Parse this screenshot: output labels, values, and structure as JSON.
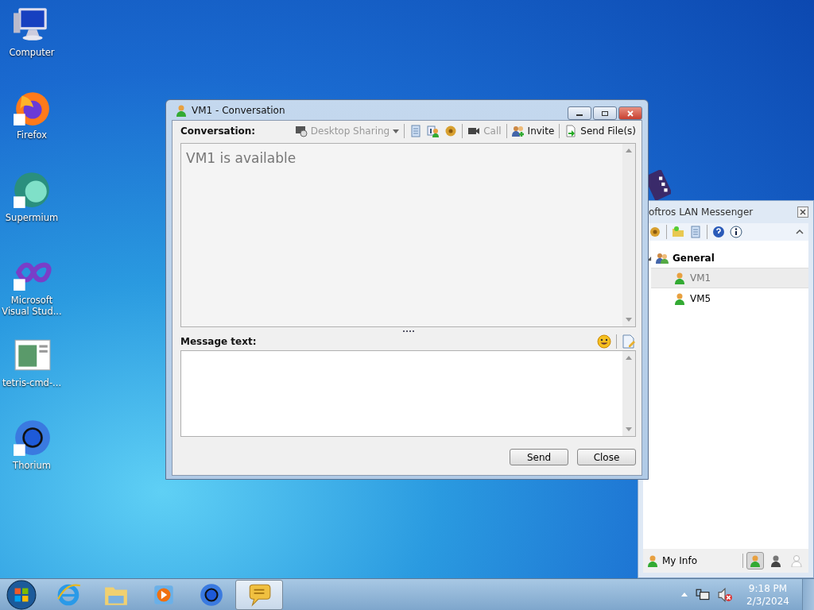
{
  "desktop_icons": [
    {
      "label": "Computer",
      "kind": "computer",
      "shortcut": false
    },
    {
      "label": "Firefox",
      "kind": "firefox",
      "shortcut": true
    },
    {
      "label": "Supermium",
      "kind": "supermium",
      "shortcut": true
    },
    {
      "label": "Microsoft Visual Stud...",
      "kind": "visualstudio",
      "shortcut": true
    },
    {
      "label": "tetris-cmd-...",
      "kind": "document",
      "shortcut": false
    },
    {
      "label": "Thorium",
      "kind": "thorium",
      "shortcut": true
    }
  ],
  "conversation_window": {
    "title": "VM1 - Conversation",
    "conversation_label": "Conversation:",
    "toolbar": [
      {
        "kind": "desktop-sharing",
        "label": "Desktop Sharing",
        "disabled": true
      },
      {
        "kind": "separator"
      },
      {
        "kind": "history"
      },
      {
        "kind": "info"
      },
      {
        "kind": "gear"
      },
      {
        "kind": "separator"
      },
      {
        "kind": "call",
        "label": "Call",
        "disabled": true
      },
      {
        "kind": "separator"
      },
      {
        "kind": "invite",
        "label": "Invite",
        "disabled": false
      },
      {
        "kind": "separator"
      },
      {
        "kind": "send-file",
        "label": "Send File(s)",
        "disabled": false
      }
    ],
    "status_text": "VM1 is available",
    "message_label": "Message text:",
    "buttons": [
      "Send",
      "Close"
    ]
  },
  "messenger_window": {
    "title": "oftros LAN Messenger",
    "tree": [
      {
        "label": "General",
        "expanded": true,
        "children": [
          {
            "label": "VM1",
            "selected": true
          },
          {
            "label": "VM5",
            "selected": false
          }
        ]
      }
    ],
    "my_info": "My Info",
    "status_buttons": [
      {
        "kind": "online",
        "selected": true
      },
      {
        "kind": "busy",
        "selected": false
      },
      {
        "kind": "offline",
        "selected": false
      }
    ]
  },
  "taskbar": {
    "apps": [
      {
        "kind": "ie",
        "selected": false
      },
      {
        "kind": "explorer",
        "selected": false
      },
      {
        "kind": "media",
        "selected": false
      },
      {
        "kind": "thorium",
        "selected": false
      },
      {
        "kind": "messenger",
        "selected": true
      }
    ],
    "time": "9:18 PM",
    "date": "2/3/2024"
  }
}
